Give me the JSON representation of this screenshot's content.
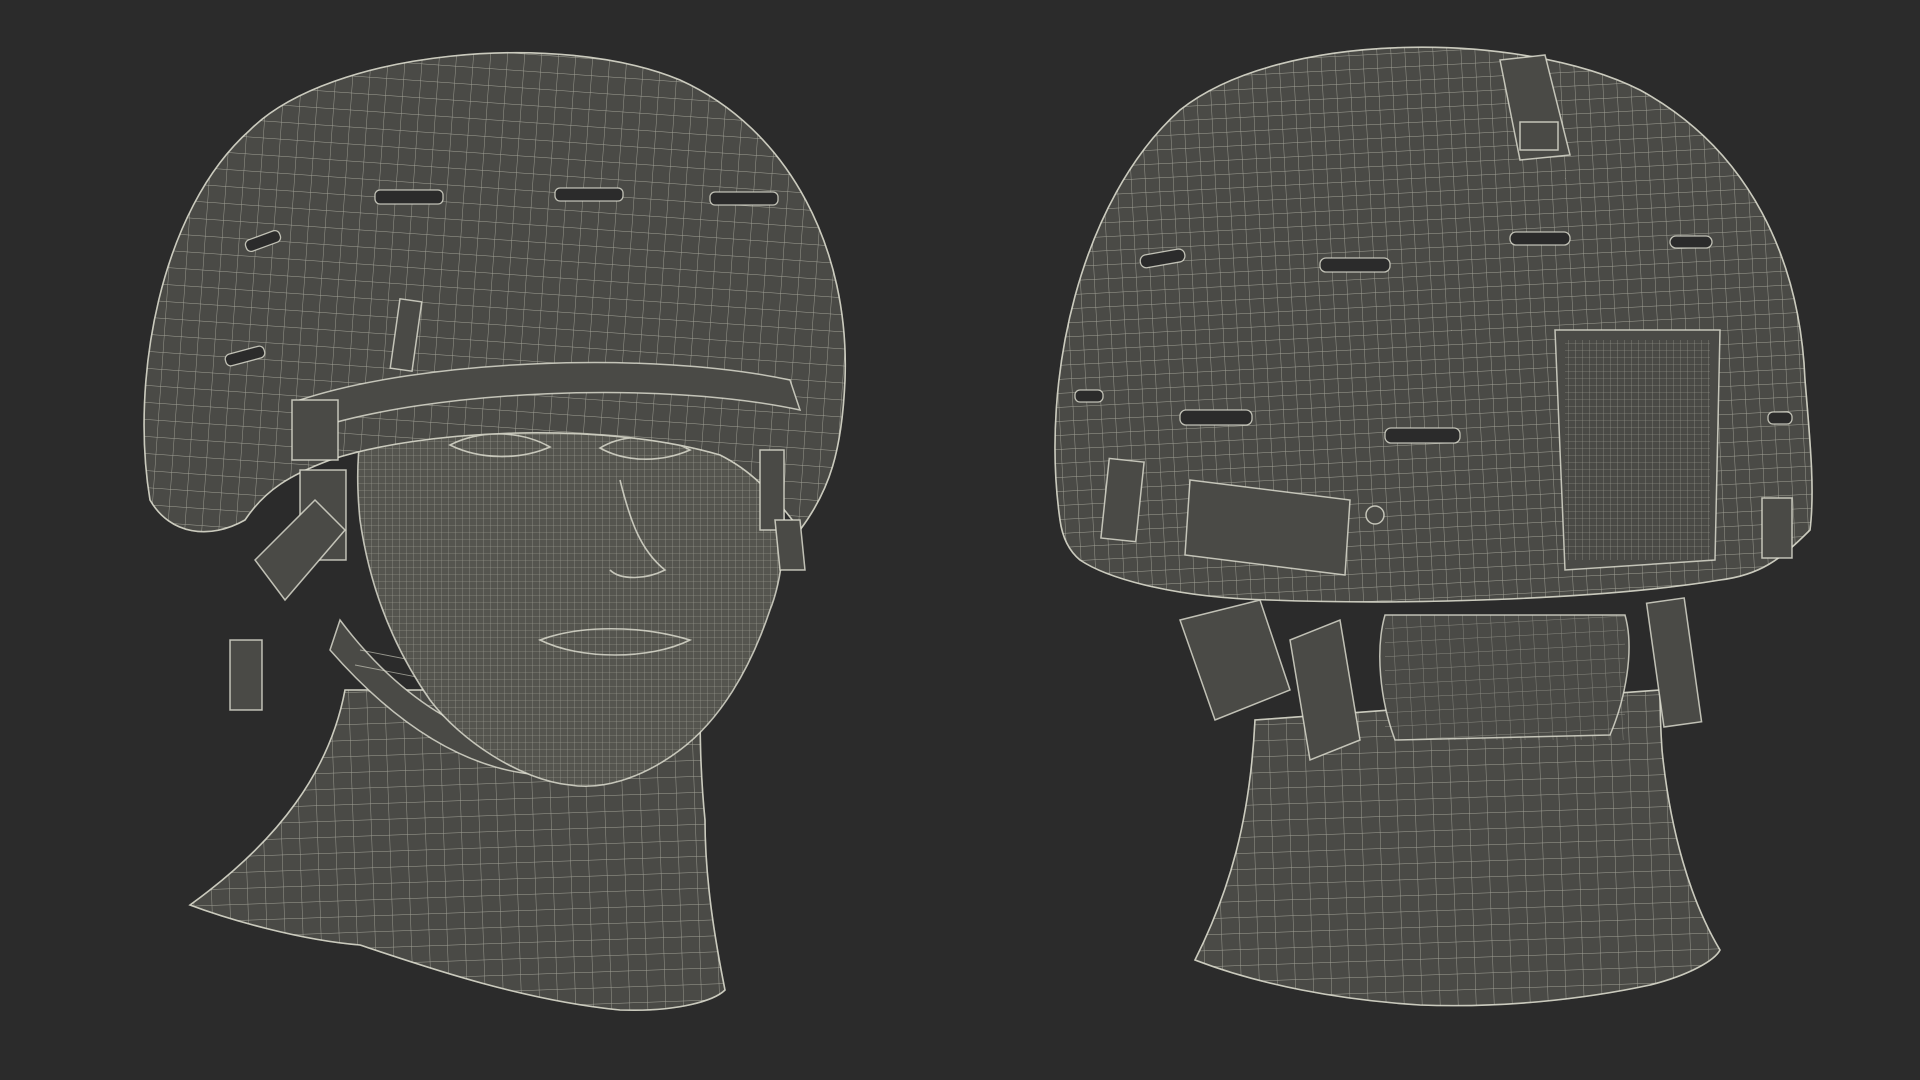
{
  "colors": {
    "background": "#2b2b2b",
    "mesh_fill": "#4a4a46",
    "wire": "#d7d7c8"
  }
}
